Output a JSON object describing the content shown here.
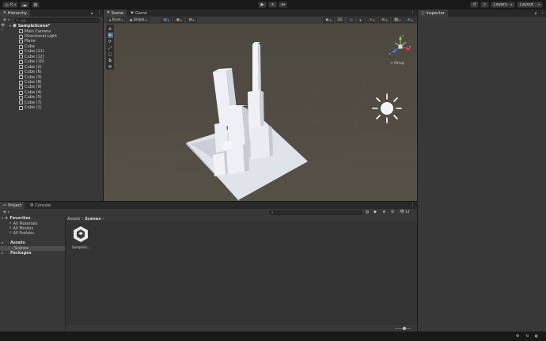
{
  "toolbar": {
    "account_initial": "R",
    "play_label": "▶",
    "pause_label": "⏸",
    "step_label": "⏭",
    "layers_label": "Layers",
    "layout_label": "Layout"
  },
  "hierarchy": {
    "tab_label": "Hierarchy",
    "search_placeholder": "All",
    "scene_name": "SampleScene*",
    "items": [
      "Main Camera",
      "Directional Light",
      "Plane",
      "Cube",
      "Cube (11)",
      "Cube (12)",
      "Cube (10)",
      "Cube (2)",
      "Cube (6)",
      "Cube (3)",
      "Cube (8)",
      "Cube (9)",
      "Cube (4)",
      "Cube (5)",
      "Cube (7)",
      "Cube (1)"
    ]
  },
  "scene_view": {
    "tabs": [
      "Scene",
      "Game"
    ],
    "pivot_label": "Pivot",
    "global_label": "Global",
    "mode_2d_label": "2D",
    "persp_label": "< Persp",
    "gizmo_axes": {
      "y": "y",
      "x": "x",
      "z": "z"
    }
  },
  "inspector": {
    "tab_label": "Inspector"
  },
  "project": {
    "tabs": [
      "Project",
      "Console"
    ],
    "favorites_label": "Favorites",
    "favorites_items": [
      "All Materials",
      "All Models",
      "All Prefabs"
    ],
    "assets_label": "Assets",
    "scenes_folder_label": "Scenes",
    "packages_label": "Packages",
    "breadcrumb_root": "Assets",
    "breadcrumb_current": "Scenes",
    "asset_count": "14",
    "file_label": "SampleSc..."
  },
  "colors": {
    "background": "#191919",
    "panel": "#383838",
    "tab_bar": "#282828",
    "scene_ground": "#4f4a42",
    "buildings": "#e8ebf1",
    "sun": "#ffffff"
  }
}
